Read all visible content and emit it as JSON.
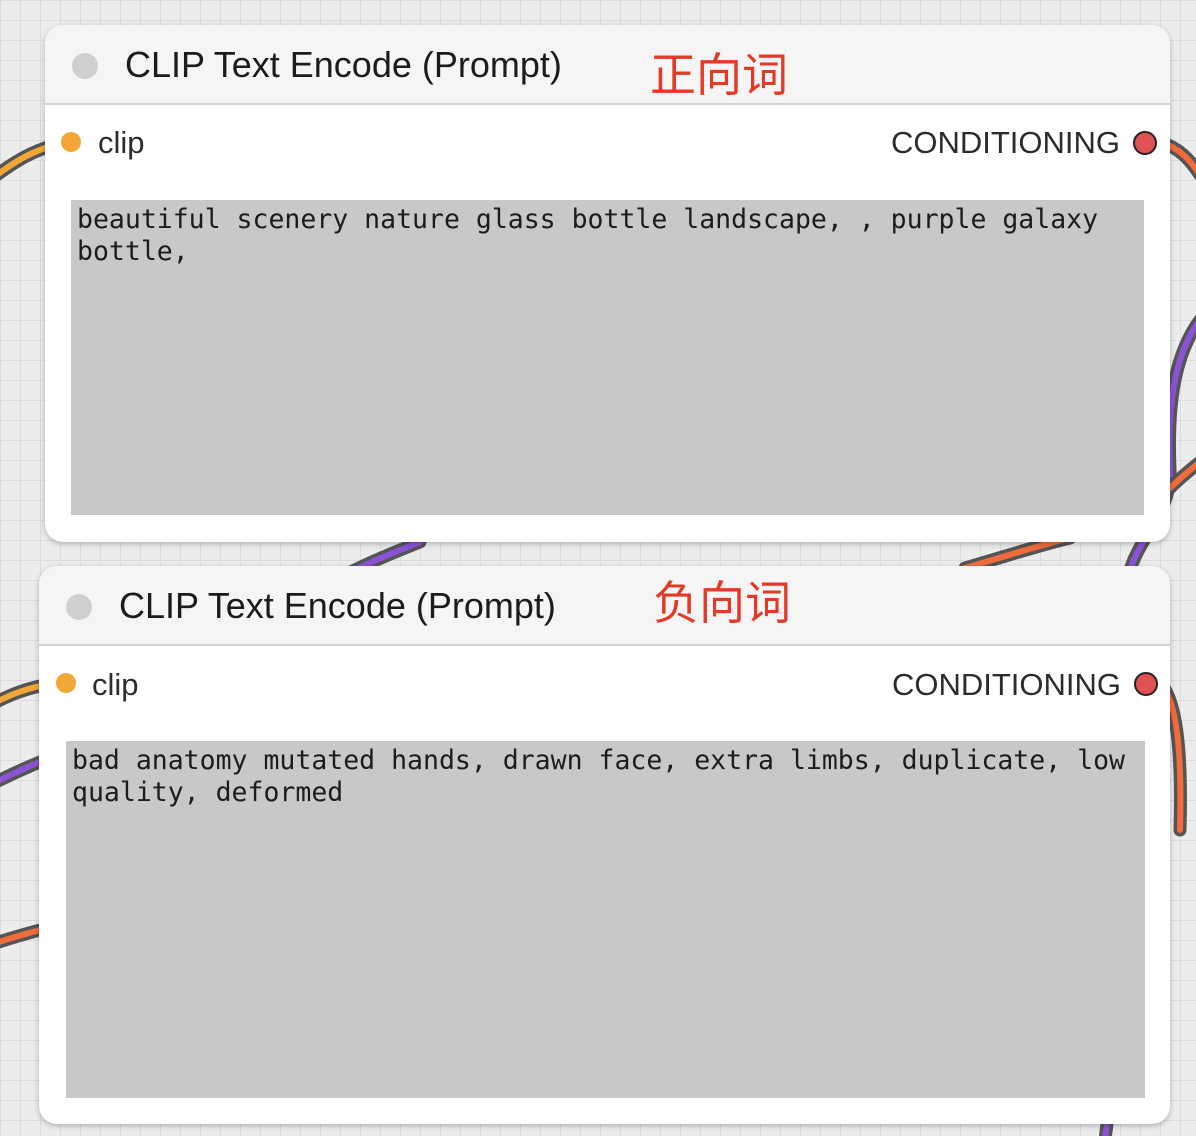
{
  "canvas": {
    "background": "#ececec",
    "wire_colors": {
      "clip": "#f3a638",
      "conditioning": "#f26b3a",
      "latent": "#8c52d6"
    }
  },
  "nodes": [
    {
      "title": "CLIP Text Encode (Prompt)",
      "annotation": "正向词",
      "input_label": "clip",
      "output_label": "CONDITIONING",
      "text": "beautiful scenery nature glass bottle landscape, , purple galaxy bottle,"
    },
    {
      "title": "CLIP Text Encode (Prompt)",
      "annotation": "负向词",
      "input_label": "clip",
      "output_label": "CONDITIONING",
      "text": "bad anatomy mutated hands, drawn face, extra limbs, duplicate, low quality, deformed"
    }
  ],
  "colors": {
    "input_slot": "#f3a638",
    "output_slot": "#e05252",
    "annotation": "#e33a28",
    "textarea_bg": "#c8c8c8"
  }
}
